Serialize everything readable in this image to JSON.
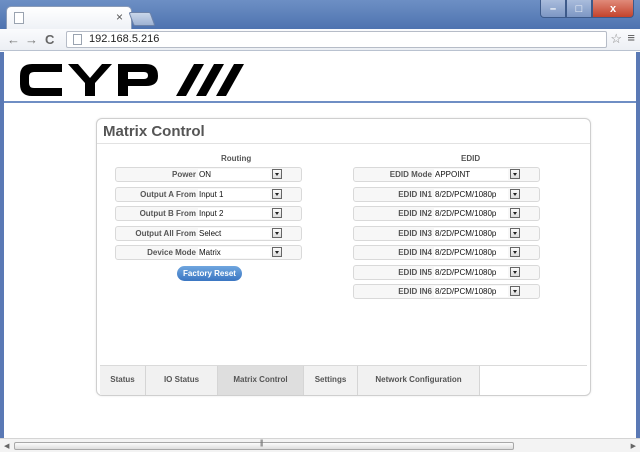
{
  "browser": {
    "url": "192.168.5.216",
    "tab_close": "×",
    "nav_back": "←",
    "nav_forward": "→",
    "nav_reload": "C",
    "star": "☆",
    "menu": "≡",
    "win_minimize": "–",
    "win_maximize": "□",
    "win_close": "x"
  },
  "page": {
    "logo_text": "CYP",
    "title": "Matrix Control",
    "routing": {
      "heading": "Routing",
      "rows": [
        {
          "label": "Power",
          "value": "ON"
        },
        {
          "label": "Output A From",
          "value": "Input 1"
        },
        {
          "label": "Output B From",
          "value": "Input 2"
        },
        {
          "label": "Output All From",
          "value": "Select"
        },
        {
          "label": "Device Mode",
          "value": "Matrix"
        }
      ],
      "factory_reset": "Factory Reset"
    },
    "edid": {
      "heading": "EDID",
      "rows": [
        {
          "label": "EDID Mode",
          "value": "APPOINT"
        },
        {
          "label": "EDID IN1",
          "value": "8/2D/PCM/1080p"
        },
        {
          "label": "EDID IN2",
          "value": "8/2D/PCM/1080p"
        },
        {
          "label": "EDID IN3",
          "value": "8/2D/PCM/1080p"
        },
        {
          "label": "EDID IN4",
          "value": "8/2D/PCM/1080p"
        },
        {
          "label": "EDID IN5",
          "value": "8/2D/PCM/1080p"
        },
        {
          "label": "EDID IN6",
          "value": "8/2D/PCM/1080p"
        }
      ]
    },
    "tabs": [
      {
        "label": "Status",
        "active": false
      },
      {
        "label": "IO Status",
        "active": false
      },
      {
        "label": "Matrix Control",
        "active": true
      },
      {
        "label": "Settings",
        "active": false
      },
      {
        "label": "Network Configuration",
        "active": false
      }
    ]
  },
  "colors": {
    "accent": "#3b76c2",
    "header_line": "#6f8ec4",
    "frame_blue": "#5a79b5"
  }
}
